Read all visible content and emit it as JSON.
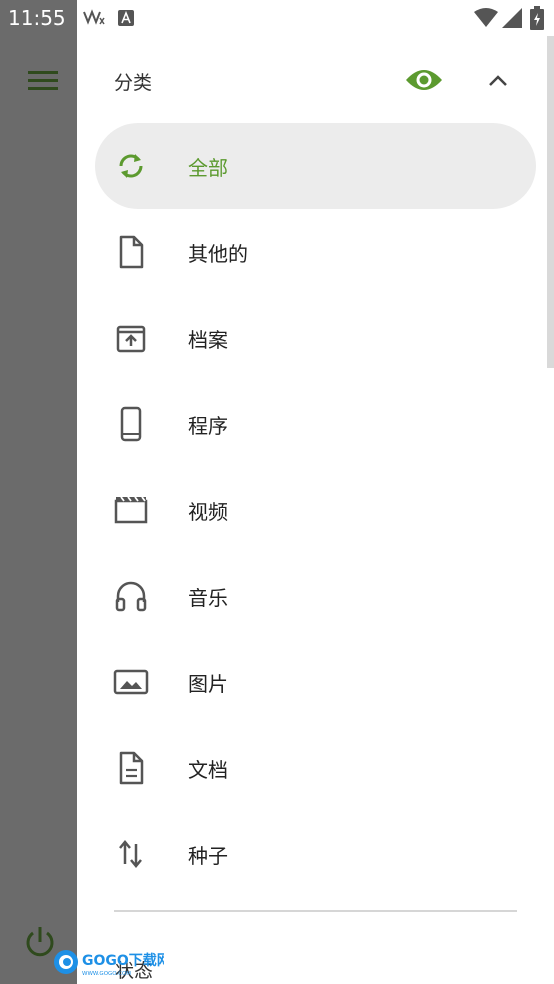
{
  "status_bar": {
    "time": "11:55",
    "icons": [
      "usb-debug-icon",
      "accessibility-a-icon",
      "wifi-icon",
      "signal-icon",
      "battery-charging-icon"
    ]
  },
  "drawer": {
    "header": {
      "title": "分类",
      "eye_icon": "eye-icon",
      "collapse_icon": "chevron-up-icon"
    },
    "items": [
      {
        "label": "全部",
        "icon": "refresh-icon",
        "selected": true
      },
      {
        "label": "其他的",
        "icon": "file-icon",
        "selected": false
      },
      {
        "label": "档案",
        "icon": "archive-icon",
        "selected": false
      },
      {
        "label": "程序",
        "icon": "phone-icon",
        "selected": false
      },
      {
        "label": "视频",
        "icon": "movie-icon",
        "selected": false
      },
      {
        "label": "音乐",
        "icon": "headphones-icon",
        "selected": false
      },
      {
        "label": "图片",
        "icon": "image-icon",
        "selected": false
      },
      {
        "label": "文档",
        "icon": "document-icon",
        "selected": false
      },
      {
        "label": "种子",
        "icon": "torrent-arrows-icon",
        "selected": false
      }
    ],
    "next_section_title": "状态"
  },
  "left_panel": {
    "menu_icon": "hamburger-menu-icon",
    "power_icon": "power-icon"
  },
  "watermark": {
    "brand": "GOGO下载网",
    "url": "WWW.GOGO.COM"
  },
  "colors": {
    "accent": "#5c9a2f",
    "selected_bg": "#ececec",
    "scrim": "#6b6b6b",
    "dark_green": "#2f4a1d"
  }
}
